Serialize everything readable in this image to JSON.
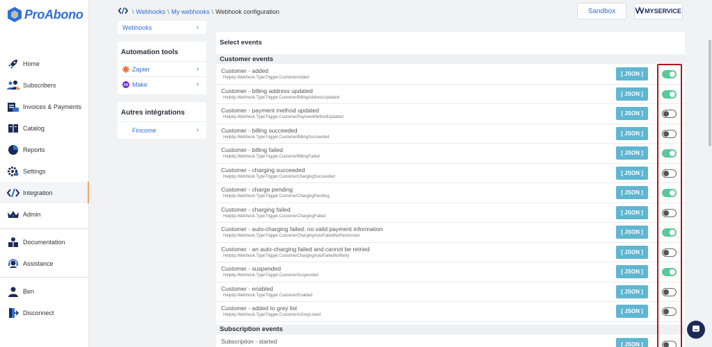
{
  "app": {
    "name": "ProAbono"
  },
  "nav": {
    "items": [
      {
        "label": "Home",
        "icon": "rocket-icon"
      },
      {
        "label": "Subscribers",
        "icon": "users-icon"
      },
      {
        "label": "Invoices & Payments",
        "icon": "invoice-icon"
      },
      {
        "label": "Catalog",
        "icon": "catalog-icon"
      },
      {
        "label": "Reports",
        "icon": "pie-chart-icon"
      },
      {
        "label": "Settings",
        "icon": "gear-icon"
      },
      {
        "label": "Integration",
        "icon": "code-icon"
      },
      {
        "label": "Admin",
        "icon": "crown-icon"
      }
    ],
    "bottom_items": [
      {
        "label": "Documentation",
        "icon": "documentation-icon"
      },
      {
        "label": "Assistance",
        "icon": "headset-icon"
      }
    ],
    "user_items": [
      {
        "label": "Ben",
        "icon": "user-icon"
      },
      {
        "label": "Disconnect",
        "icon": "logout-icon"
      }
    ]
  },
  "breadcrumb": {
    "items": [
      "Webhooks",
      "My webhooks"
    ],
    "current": "Webhook configuration",
    "sep": "\\"
  },
  "header": {
    "sandbox_label": "Sandbox",
    "brand": "MYSERVICE"
  },
  "left_panels": {
    "webhooks_link": "Webhooks",
    "automation": {
      "title": "Automation tools",
      "items": [
        "Zapier",
        "Make"
      ]
    },
    "other": {
      "title": "Autres intégrations",
      "items": [
        "Fincome"
      ]
    }
  },
  "main": {
    "title": "Select events",
    "json_label": "[ JSON ]",
    "sections": [
      {
        "title": "Customer events",
        "events": [
          {
            "label": "Customer - added",
            "key": "Helptip.Webhook.TypeTrigger.CustomerAdded",
            "enabled": true
          },
          {
            "label": "Customer - billing address updated",
            "key": "Helptip.Webhook.TypeTrigger.CustomerBillingAddressUpdated",
            "enabled": true
          },
          {
            "label": "Customer - payment method updated",
            "key": "Helptip.Webhook.TypeTrigger.CustomerPaymentMethodUpdated",
            "enabled": false
          },
          {
            "label": "Customer - billing succeeded",
            "key": "Helptip.Webhook.TypeTrigger.CustomerBillingSucceeded",
            "enabled": false
          },
          {
            "label": "Customer - billing failed",
            "key": "Helptip.Webhook.TypeTrigger.CustomerBillingFailed",
            "enabled": true
          },
          {
            "label": "Customer - charging succeeded",
            "key": "Helptip.Webhook.TypeTrigger.CustomerChargingSucceeded",
            "enabled": false
          },
          {
            "label": "Customer - charge pending",
            "key": "Helptip.Webhook.TypeTrigger.CustomerChargingPending",
            "enabled": true
          },
          {
            "label": "Customer - charging failed",
            "key": "Helptip.Webhook.TypeTrigger.CustomerChargingFailed",
            "enabled": false
          },
          {
            "label": "Customer - auto-charging failed: no valid payment information",
            "key": "Helptip.Webhook.TypeTrigger.CustomerChargingAutoFailedNoPermission",
            "enabled": true
          },
          {
            "label": "Customer - an auto-charging failed and cannot be retried",
            "key": "Helptip.Webhook.TypeTrigger.CustomerChargingAutoFailedNoRetry",
            "enabled": false
          },
          {
            "label": "Customer - suspended",
            "key": "Helptip.Webhook.TypeTrigger.CustomerSuspended",
            "enabled": true
          },
          {
            "label": "Customer - enabled",
            "key": "Helptip.Webhook.TypeTrigger.CustomerEnabled",
            "enabled": false
          },
          {
            "label": "Customer - added to grey list",
            "key": "Helptip.Webhook.TypeTrigger.CustomerIsGreyListed",
            "enabled": false
          }
        ]
      },
      {
        "title": "Subscription events",
        "events": [
          {
            "label": "Subscription - started",
            "key": "",
            "enabled": false
          }
        ]
      }
    ]
  },
  "colors": {
    "accent": "#2f6fd6",
    "json_button": "#5fb6d1",
    "toggle_on": "#5cc79b",
    "highlight": "#b1141b",
    "active_marker": "#f0a35e"
  }
}
